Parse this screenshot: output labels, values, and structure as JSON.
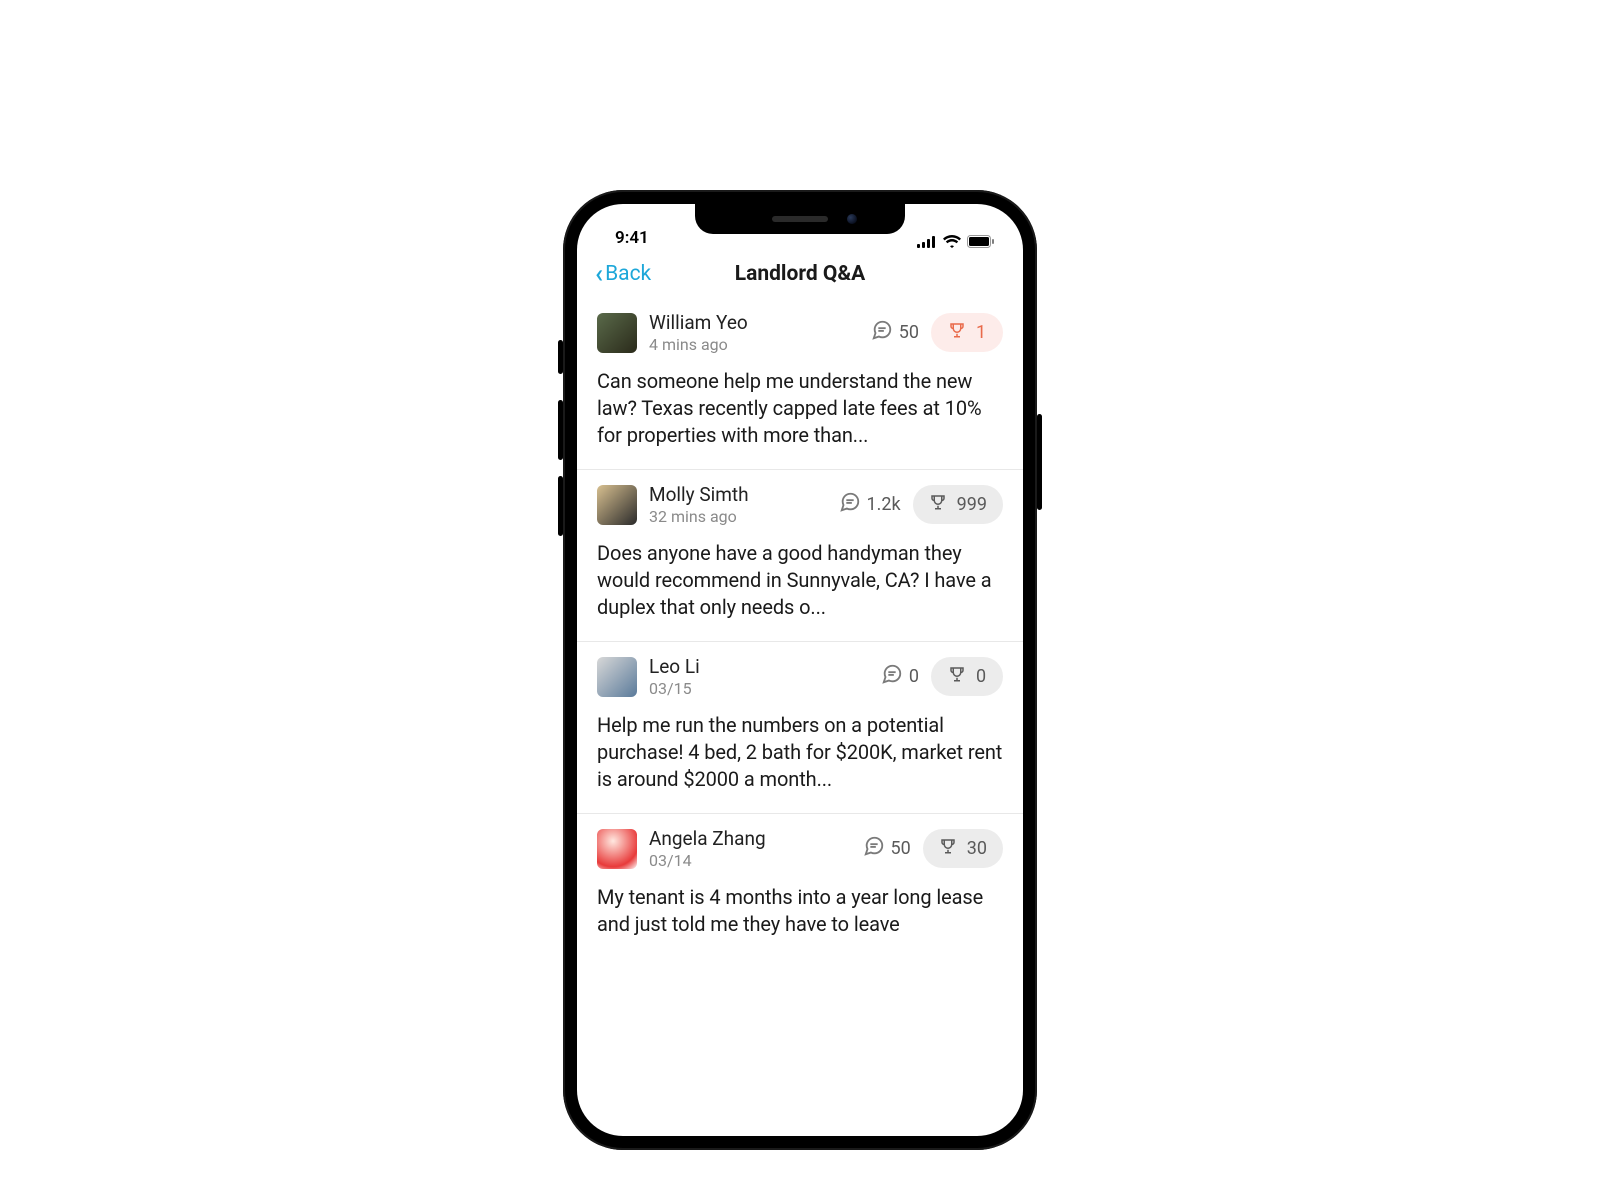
{
  "status_bar": {
    "time": "9:41"
  },
  "nav": {
    "back_label": "Back",
    "title": "Landlord Q&A"
  },
  "posts": [
    {
      "author": "William Yeo",
      "timestamp": "4 mins ago",
      "comments": "50",
      "awards": "1",
      "award_hot": true,
      "body": "Can someone help me understand the new law? Texas recently capped late fees at 10% for properties with more than..."
    },
    {
      "author": "Molly Simth",
      "timestamp": "32 mins ago",
      "comments": "1.2k",
      "awards": "999",
      "award_hot": false,
      "body": "Does anyone have a good handyman they would recommend in Sunnyvale, CA? I have a duplex that only needs o..."
    },
    {
      "author": "Leo Li",
      "timestamp": "03/15",
      "comments": "0",
      "awards": "0",
      "award_hot": false,
      "body": "Help me run the numbers on a potential purchase! 4 bed, 2 bath for $200K, market rent is around $2000 a month..."
    },
    {
      "author": "Angela Zhang",
      "timestamp": "03/14",
      "comments": "50",
      "awards": "30",
      "award_hot": false,
      "body": "My tenant is 4 months into a year long lease and just told me they have to leave"
    }
  ]
}
